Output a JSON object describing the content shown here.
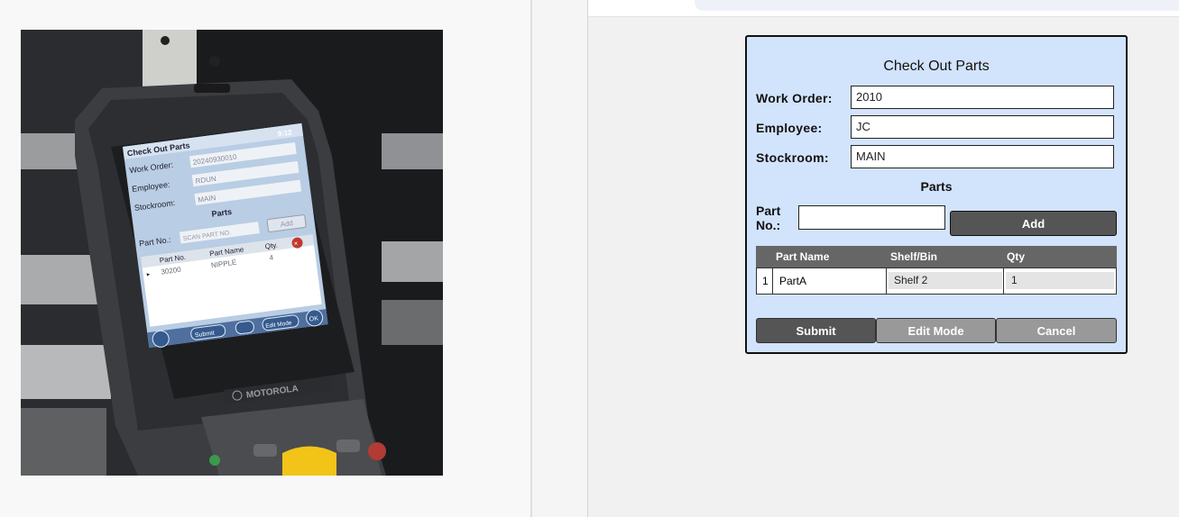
{
  "photo": {
    "screen": {
      "title": "Check Out Parts",
      "time": "9:12",
      "work_order_label": "Work Order:",
      "work_order_value": "20240930010",
      "employee_label": "Employee:",
      "employee_value": "RDUN",
      "stockroom_label": "Stockroom:",
      "stockroom_value": "MAIN",
      "parts_heading": "Parts",
      "part_no_label": "Part No.:",
      "part_no_placeholder": "SCAN PART NO.",
      "add_label": "Add",
      "columns": [
        "Part No.",
        "Part Name",
        "Qty."
      ],
      "row": {
        "part_no": "30200",
        "part_name": "NIPPLE",
        "qty": "4"
      },
      "soft_submit": "Submit",
      "soft_edit": "Edit Mode",
      "soft_ok": "OK"
    },
    "brand": "MOTOROLA"
  },
  "form": {
    "title": "Check Out Parts",
    "work_order_label": "Work Order:",
    "work_order_value": "2010",
    "employee_label": "Employee:",
    "employee_value": "JC",
    "stockroom_label": "Stockroom:",
    "stockroom_value": "MAIN",
    "parts_heading": "Parts",
    "part_no_label_1": "Part",
    "part_no_label_2": "No.:",
    "part_no_value": "",
    "add_label": "Add",
    "table": {
      "columns": [
        "Part Name",
        "Shelf/Bin",
        "Qty"
      ],
      "rows": [
        {
          "index": "1",
          "part_name": "PartA",
          "shelf_bin": "Shelf 2",
          "qty": "1"
        }
      ]
    },
    "submit_label": "Submit",
    "edit_mode_label": "Edit Mode",
    "cancel_label": "Cancel"
  },
  "colors": {
    "panel_bg": "#d2e3fc",
    "dark_button": "#555555",
    "light_button": "#999999",
    "table_header": "#666666"
  }
}
